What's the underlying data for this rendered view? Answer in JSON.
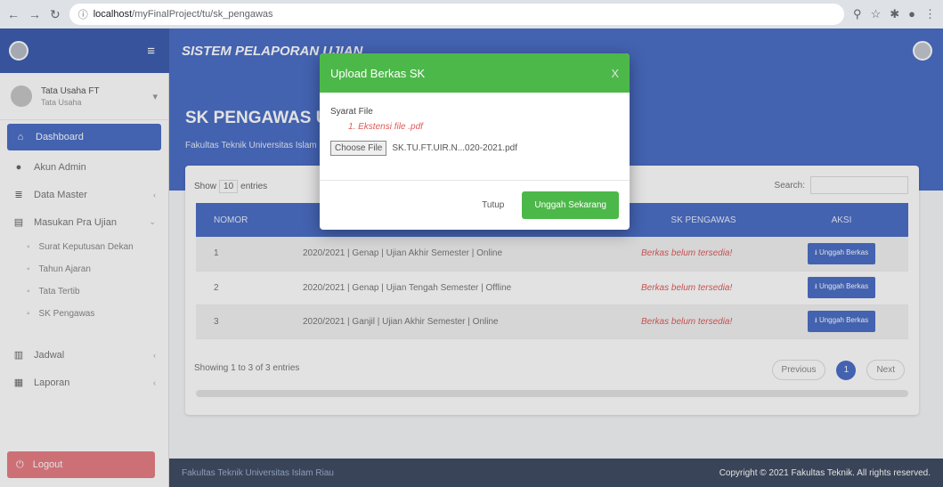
{
  "browser": {
    "url_host": "localhost",
    "url_path": "/myFinalProject/tu/sk_pengawas"
  },
  "app": {
    "title": "SISTEM PELAPORAN UJIAN"
  },
  "user": {
    "name": "Tata Usaha FT",
    "role": "Tata Usaha"
  },
  "sidebar": {
    "items": [
      {
        "label": "Dashboard",
        "icon": "home-icon"
      },
      {
        "label": "Akun Admin",
        "icon": "user-icon"
      },
      {
        "label": "Data Master",
        "icon": "database-icon"
      },
      {
        "label": "Masukan Pra Ujian",
        "icon": "form-icon"
      },
      {
        "label": "Surat Keputusan Dekan"
      },
      {
        "label": "Tahun Ajaran"
      },
      {
        "label": "Tata Tertib"
      },
      {
        "label": "SK Pengawas"
      },
      {
        "label": "Jadwal",
        "icon": "calendar-icon"
      },
      {
        "label": "Laporan",
        "icon": "report-icon"
      }
    ],
    "logout": "Logout"
  },
  "page": {
    "title": "SK PENGAWAS UJIAN",
    "subtitle": "Fakultas Teknik Universitas Islam Riau"
  },
  "table": {
    "show_label": "Show",
    "show_value": "10",
    "entries_label": "entries",
    "search_label": "Search:",
    "headers": [
      "NOMOR",
      "",
      "SK PENGAWAS",
      "AKSI"
    ],
    "rows": [
      {
        "no": "1",
        "ujian": "2020/2021 | Genap | Ujian Akhir Semester | Online",
        "sk": "Berkas belum tersedia!",
        "aksi": "Unggah Berkas"
      },
      {
        "no": "2",
        "ujian": "2020/2021 | Genap | Ujian Tengah Semester | Offline",
        "sk": "Berkas belum tersedia!",
        "aksi": "Unggah Berkas"
      },
      {
        "no": "3",
        "ujian": "2020/2021 | Ganjil | Ujian Akhir Semester | Online",
        "sk": "Berkas belum tersedia!",
        "aksi": "Unggah Berkas"
      }
    ],
    "info": "Showing 1 to 3 of 3 entries",
    "prev": "Previous",
    "page": "1",
    "next": "Next"
  },
  "footer": {
    "left": "Fakultas Teknik Universitas Islam Riau",
    "right": "Copyright © 2021 Fakultas Teknik. All rights reserved."
  },
  "modal": {
    "title": "Upload Berkas SK",
    "close_x": "X",
    "label": "Syarat File",
    "note": "1. Ekstensi file .pdf",
    "choose_file": "Choose File",
    "file_name": "SK.TU.FT.UIR.N...020-2021.pdf",
    "close": "Tutup",
    "upload": "Unggah Sekarang"
  },
  "colors": {
    "primary": "#4a6ec6",
    "success": "#4db84a",
    "danger": "#e05a5a",
    "logout": "#e77e84"
  }
}
